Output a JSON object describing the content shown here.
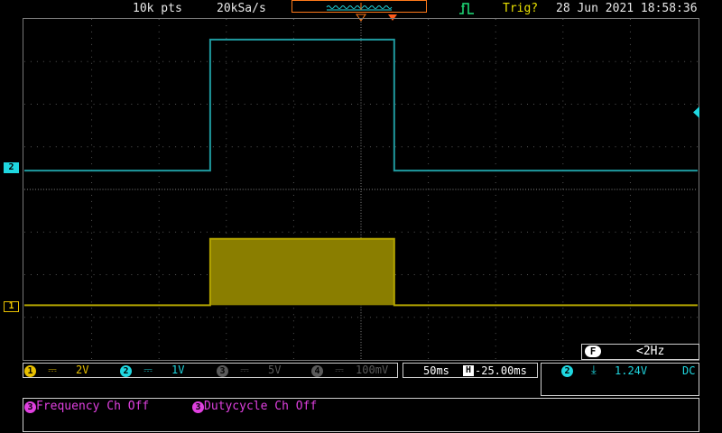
{
  "top": {
    "record_length": "10k pts",
    "sample_rate": "20kSa/s",
    "trigger_state": "Trig?",
    "datetime": "28 Jun 2021 18:58:36"
  },
  "channels": [
    {
      "num": "1",
      "coupling_icon": "dc-coupling-icon",
      "scale": "2V",
      "color": "#e8c000"
    },
    {
      "num": "2",
      "coupling_icon": "dc-coupling-icon",
      "scale": "1V",
      "color": "#1fd7e0"
    },
    {
      "num": "3",
      "coupling_icon": "dc-coupling-icon",
      "scale": "5V",
      "color": "#5a5a5a"
    },
    {
      "num": "4",
      "coupling_icon": "dc-coupling-icon",
      "scale": "100mV",
      "color": "#5a5a5a"
    }
  ],
  "timebase": {
    "scale": "50ms",
    "position": "-25.00ms",
    "position_icon_label": "H"
  },
  "trigger": {
    "source": "2",
    "slope_icon": "falling-edge-icon",
    "level": "1.24V",
    "coupling": "DC"
  },
  "frequency": {
    "label": "F",
    "value": "<2Hz"
  },
  "markers": {
    "ch1": "1",
    "ch2": "2"
  },
  "measurements": [
    {
      "source": "3",
      "text": "Frequency Ch Off"
    },
    {
      "source": "3",
      "text": "Dutycycle Ch Off"
    }
  ],
  "colors": {
    "ch1": "#b3a400",
    "ch2": "#1f9aa0",
    "memory_border": "#ff7a1a",
    "trigger_marker": "#ff5a1a",
    "measure": "#e040e0"
  }
}
